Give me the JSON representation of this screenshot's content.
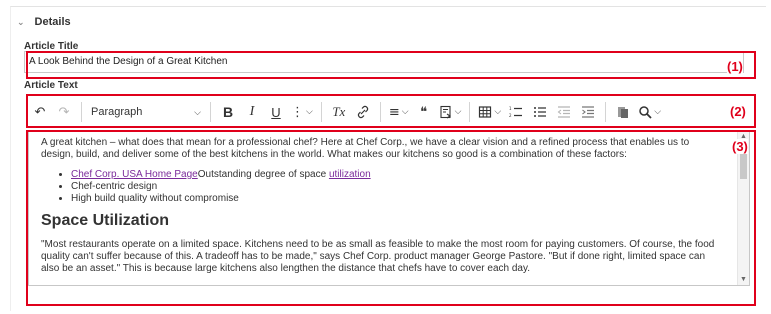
{
  "section": {
    "chevron_icon": "chevron-down",
    "title": "Details"
  },
  "article_title": {
    "label": "Article Title",
    "value": "A Look Behind the Design of a Great Kitchen"
  },
  "article_text": {
    "label": "Article Text"
  },
  "toolbar": {
    "undo": "↶",
    "redo": "↷",
    "paragraph_value": "Paragraph",
    "bold": "B",
    "italic": "I",
    "underline": "U",
    "more": "⋮",
    "clear_format": "Tx",
    "link": "🔗",
    "align": "≡",
    "quote": "❝",
    "insert": "⊞",
    "table": "▦",
    "numbered_list": "≔",
    "bulleted_list": "☰",
    "outdent": "⇤",
    "indent": "⇥",
    "paste": "📋",
    "find_replace": "🔍"
  },
  "editor": {
    "intro": "A great kitchen – what does that mean for a professional chef? Here at Chef Corp., we have a clear vision and a refined process that enables us to design, build, and deliver some of the best kitchens in the world. What makes our kitchens so good is a combination of these factors:",
    "list": {
      "item1_link": "Chef Corp. USA Home Page",
      "item1_text": "Outstanding degree of space ",
      "item1_link2": "utilization",
      "item2": "Chef-centric design",
      "item3": "High build quality without compromise"
    },
    "heading": "Space Utilization",
    "para2": "\"Most restaurants operate on a limited space. Kitchens need to be as small as feasible to make the most room for paying customers. Of course, the food quality can't suffer because of this. A tradeoff has to be made,\" says Chef Corp. product manager George Pastore. \"But if done right, limited space can also be an asset.\" This is because large kitchens also lengthen the distance that chefs have to cover each day."
  },
  "annotations": [
    "(1)",
    "(2)",
    "(3)"
  ],
  "colors": {
    "highlight": "#e0001b",
    "link": "#2060c0",
    "visited_link": "#7a2a9a"
  }
}
